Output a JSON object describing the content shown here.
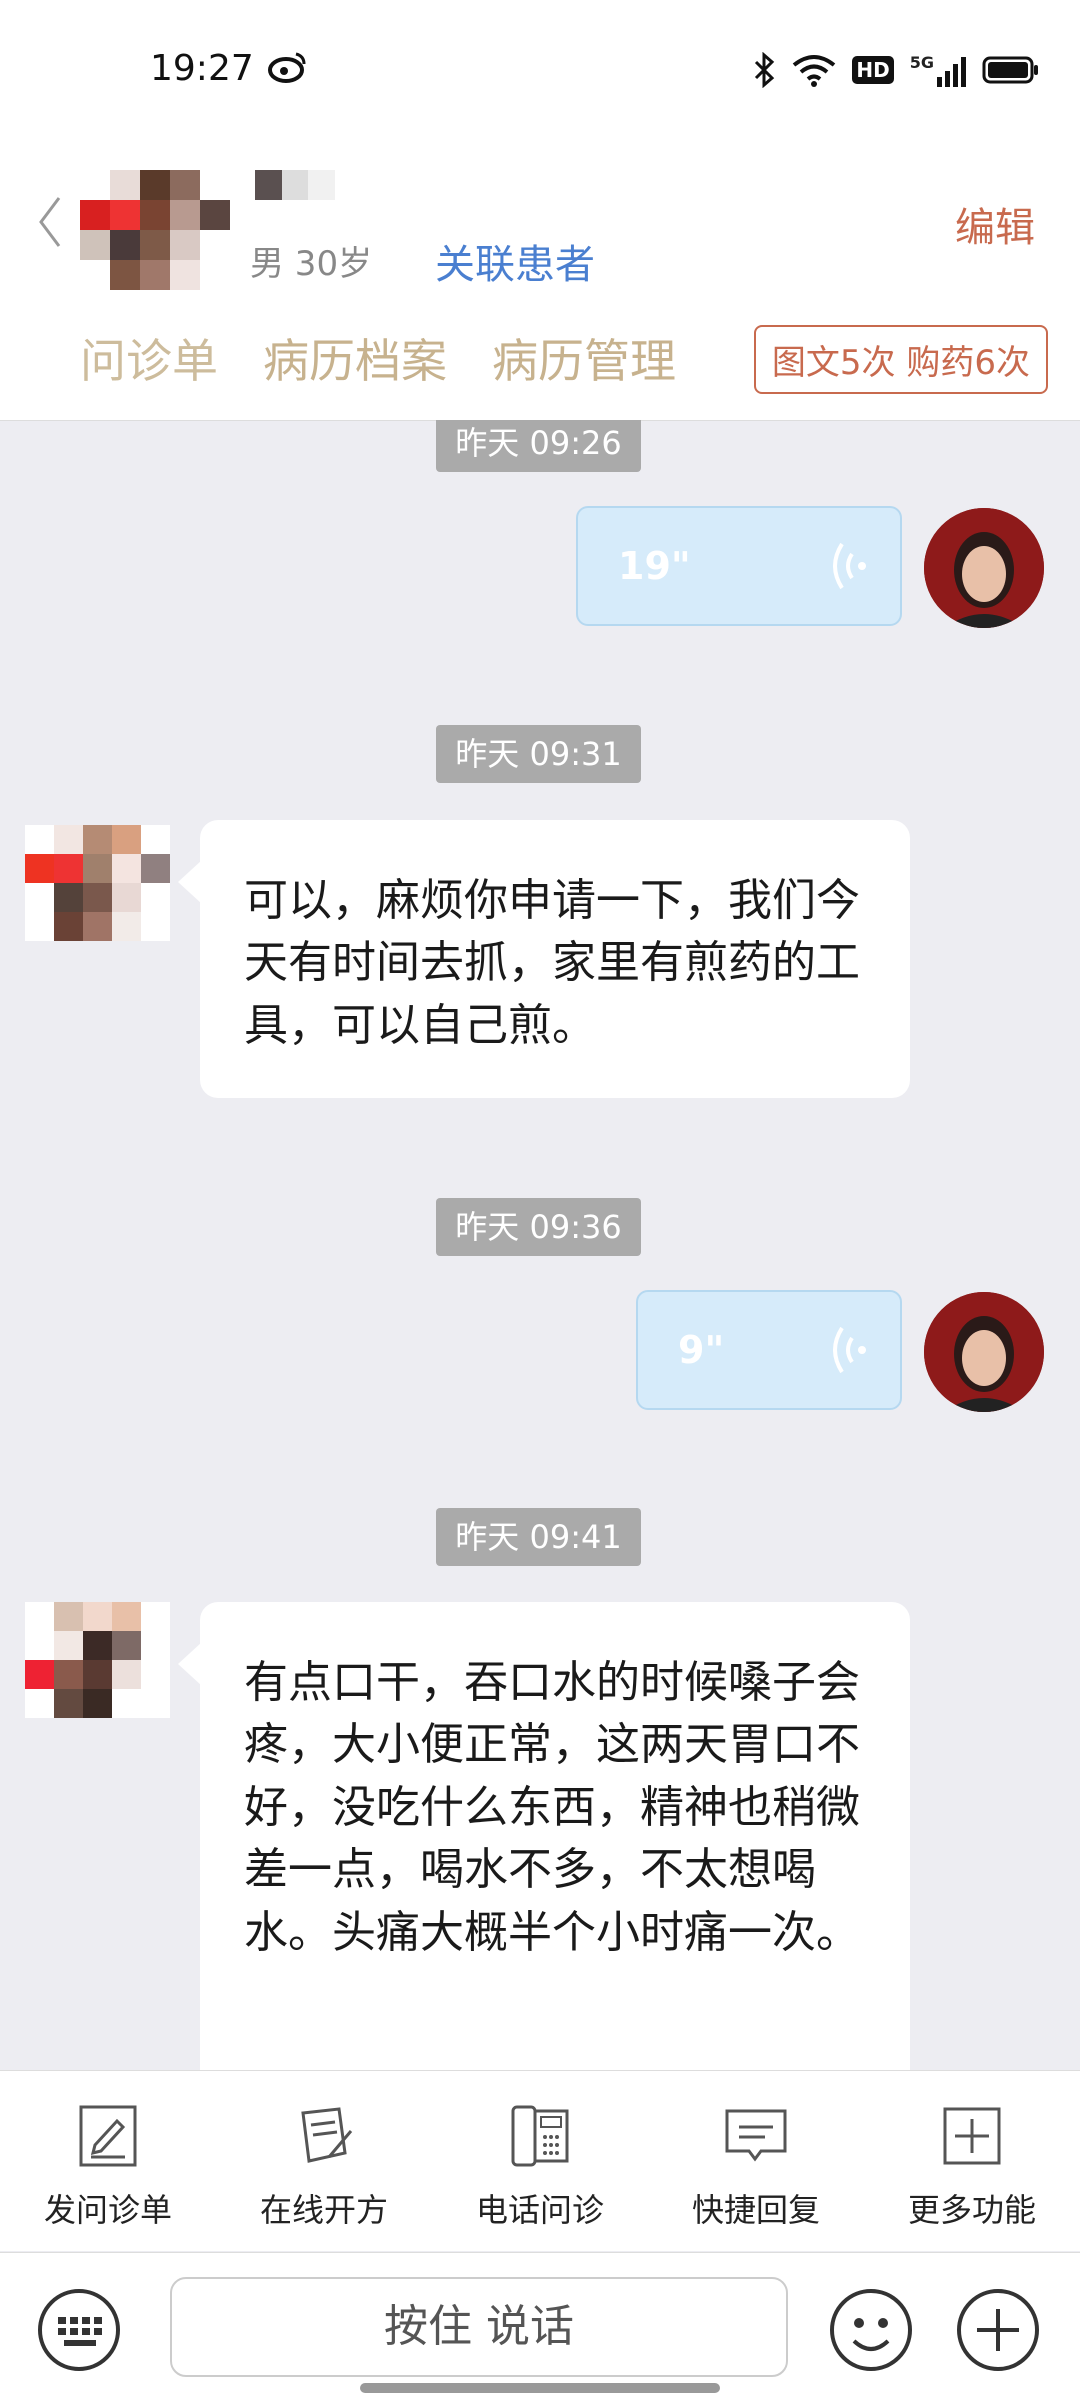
{
  "status_bar": {
    "time": "19:27",
    "hd": "HD",
    "signal": "5G"
  },
  "header": {
    "gender_age": "男 30岁",
    "link_patient": "关联患者",
    "edit": "编辑",
    "tabs": [
      "问诊单",
      "病历档案",
      "病历管理"
    ],
    "quota": "图文5次 购药6次"
  },
  "messages": [
    {
      "type": "timestamp",
      "text": "昨天 09:26"
    },
    {
      "type": "voice",
      "duration": "19\""
    },
    {
      "type": "timestamp",
      "text": "昨天 09:31"
    },
    {
      "type": "text",
      "text": "可以，麻烦你申请一下，我们今天有时间去抓，家里有煎药的工具，可以自己煎。"
    },
    {
      "type": "timestamp",
      "text": "昨天 09:36"
    },
    {
      "type": "voice",
      "duration": "9\""
    },
    {
      "type": "timestamp",
      "text": "昨天 09:41"
    },
    {
      "type": "text",
      "text": "有点口干，吞口水的时候嗓子会疼，大小便正常，这两天胃口不好，没吃什么东西，精神也稍微差一点，喝水不多，不太想喝水。头痛大概半个小时痛一次。"
    }
  ],
  "functions": [
    "发问诊单",
    "在线开方",
    "电话问诊",
    "快捷回复",
    "更多功能"
  ],
  "input": {
    "hold_to_talk": "按住 说话"
  }
}
